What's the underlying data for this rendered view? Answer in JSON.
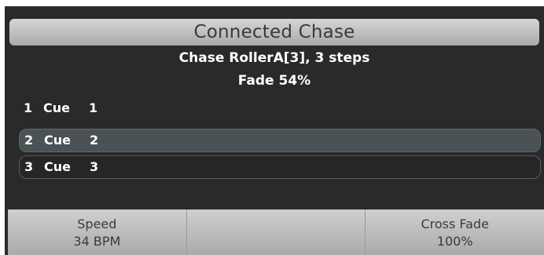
{
  "header": {
    "title": "Connected Chase",
    "chase_info": "Chase RollerA[3], 3 steps",
    "fade_info": "Fade 54%"
  },
  "steps": [
    {
      "number": "1",
      "label": "Cue",
      "value": "1",
      "selected": false
    },
    {
      "number": "2",
      "label": "Cue",
      "value": "2",
      "selected": true
    },
    {
      "number": "3",
      "label": "Cue",
      "value": "3",
      "selected": false
    }
  ],
  "footer": {
    "speed_label": "Speed",
    "speed_value": "34 BPM",
    "middle_label": "",
    "middle_value": "",
    "crossfade_label": "Cross Fade",
    "crossfade_value": "100%"
  },
  "colors": {
    "panel_bg": "#2a2a2a",
    "selected_row": "#4a5256",
    "button_gradient_top": "#d6d6d6",
    "button_gradient_bottom": "#a9a9a9"
  }
}
